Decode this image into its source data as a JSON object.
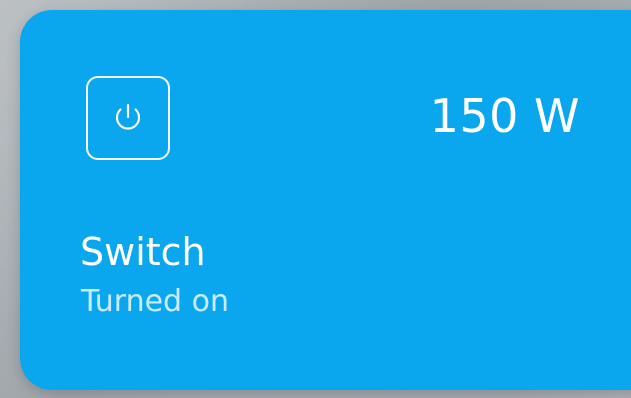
{
  "card": {
    "accent_color": "#0aa7ef",
    "icon": "power-icon",
    "power_reading": "150 W",
    "device_name": "Switch",
    "device_status": "Turned on"
  }
}
